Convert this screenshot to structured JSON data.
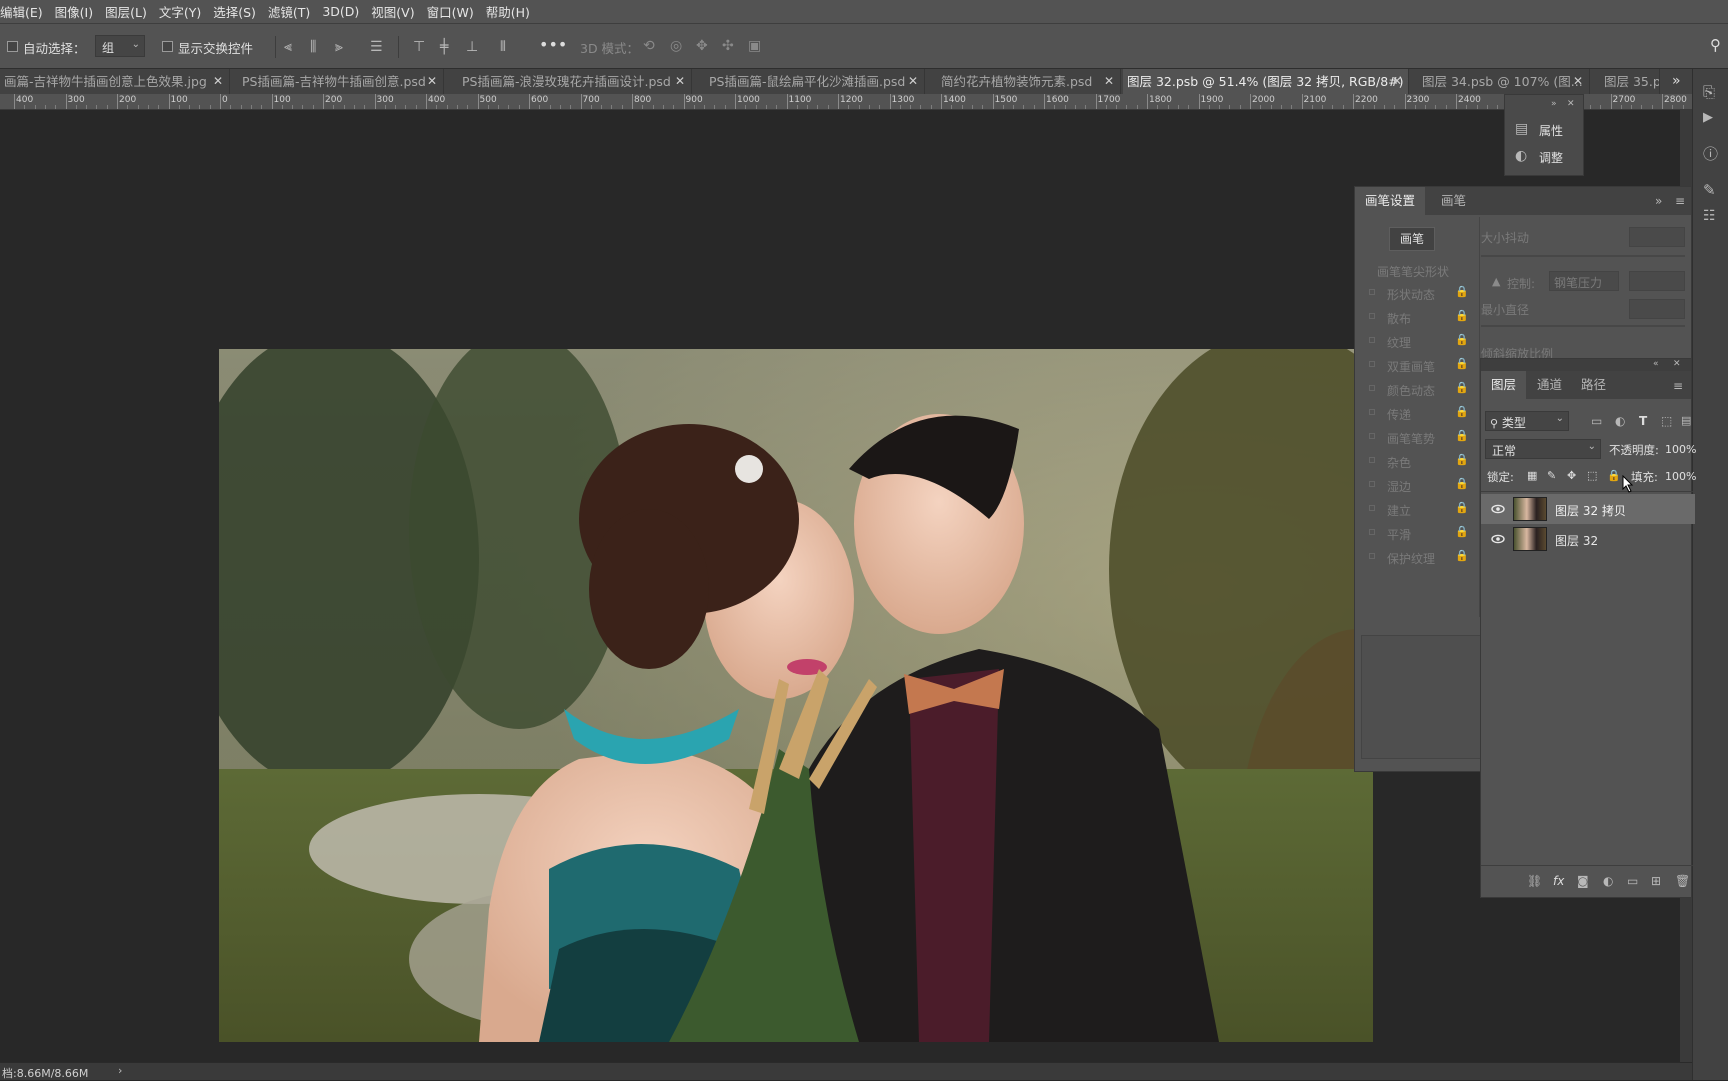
{
  "menu": {
    "items": [
      "编辑(E)",
      "图像(I)",
      "图层(L)",
      "文字(Y)",
      "选择(S)",
      "滤镜(T)",
      "3D(D)",
      "视图(V)",
      "窗口(W)",
      "帮助(H)"
    ]
  },
  "options_bar": {
    "auto_select_label": "自动选择：",
    "auto_select_value": "组",
    "show_transform_label": "显示交换控件",
    "mode_3d_label": "3D 模式："
  },
  "tabs": [
    {
      "label": "画篇-吉祥物牛插画创意上色效果.jpg",
      "active": false
    },
    {
      "label": "PS插画篇-吉祥物牛插画创意.psd",
      "active": false
    },
    {
      "label": "PS插画篇-浪漫玫瑰花卉插画设计.psd",
      "active": false
    },
    {
      "label": "PS插画篇-鼠绘扁平化沙滩插画.psd",
      "active": false
    },
    {
      "label": "简约花卉植物装饰元素.psd",
      "active": false
    },
    {
      "label": "图层 32.psb @ 51.4% (图层 32 拷贝, RGB/8#) *",
      "active": true
    },
    {
      "label": "图层 34.psb @ 107% (图...",
      "active": false
    },
    {
      "label": "图层 35.p",
      "active": false
    }
  ],
  "ruler_labels": [
    "400",
    "300",
    "200",
    "100",
    "0",
    "100",
    "200",
    "300",
    "400",
    "500",
    "600",
    "700",
    "800",
    "900",
    "1000",
    "1100",
    "1200",
    "1300",
    "1400",
    "1500",
    "1600",
    "1700",
    "1800",
    "1900",
    "2000",
    "2100",
    "2200",
    "2300",
    "2400",
    "2500",
    "2600",
    "2700",
    "2800"
  ],
  "properties_popup": {
    "items": [
      "属性",
      "调整"
    ]
  },
  "brush_panel": {
    "tabs": [
      "画笔设置",
      "画笔"
    ],
    "brush_button": "画笔",
    "tip_shape_label": "画笔笔尖形状",
    "options": [
      "形状动态",
      "散布",
      "纹理",
      "双重画笔",
      "颜色动态",
      "传递",
      "画笔笔势",
      "杂色",
      "湿边",
      "建立",
      "平滑",
      "保护纹理"
    ],
    "size_jitter_label": "大小抖动",
    "control_label": "控制:",
    "control_value": "钢笔压力",
    "min_diameter_label": "最小直径",
    "tilt_scale_label": "倾斜缩放比例"
  },
  "layers_panel": {
    "tabs": [
      "图层",
      "通道",
      "路径"
    ],
    "filter_type": "类型",
    "blend_mode": "正常",
    "opacity_label": "不透明度:",
    "opacity_value": "100%",
    "lock_label": "锁定:",
    "fill_label": "填充:",
    "fill_value": "100%",
    "layers": [
      {
        "name": "图层 32 拷贝",
        "visible": true,
        "selected": true
      },
      {
        "name": "图层 32",
        "visible": true,
        "selected": false
      }
    ]
  },
  "status_bar": {
    "doc_size": "档:8.66M/8.66M"
  }
}
